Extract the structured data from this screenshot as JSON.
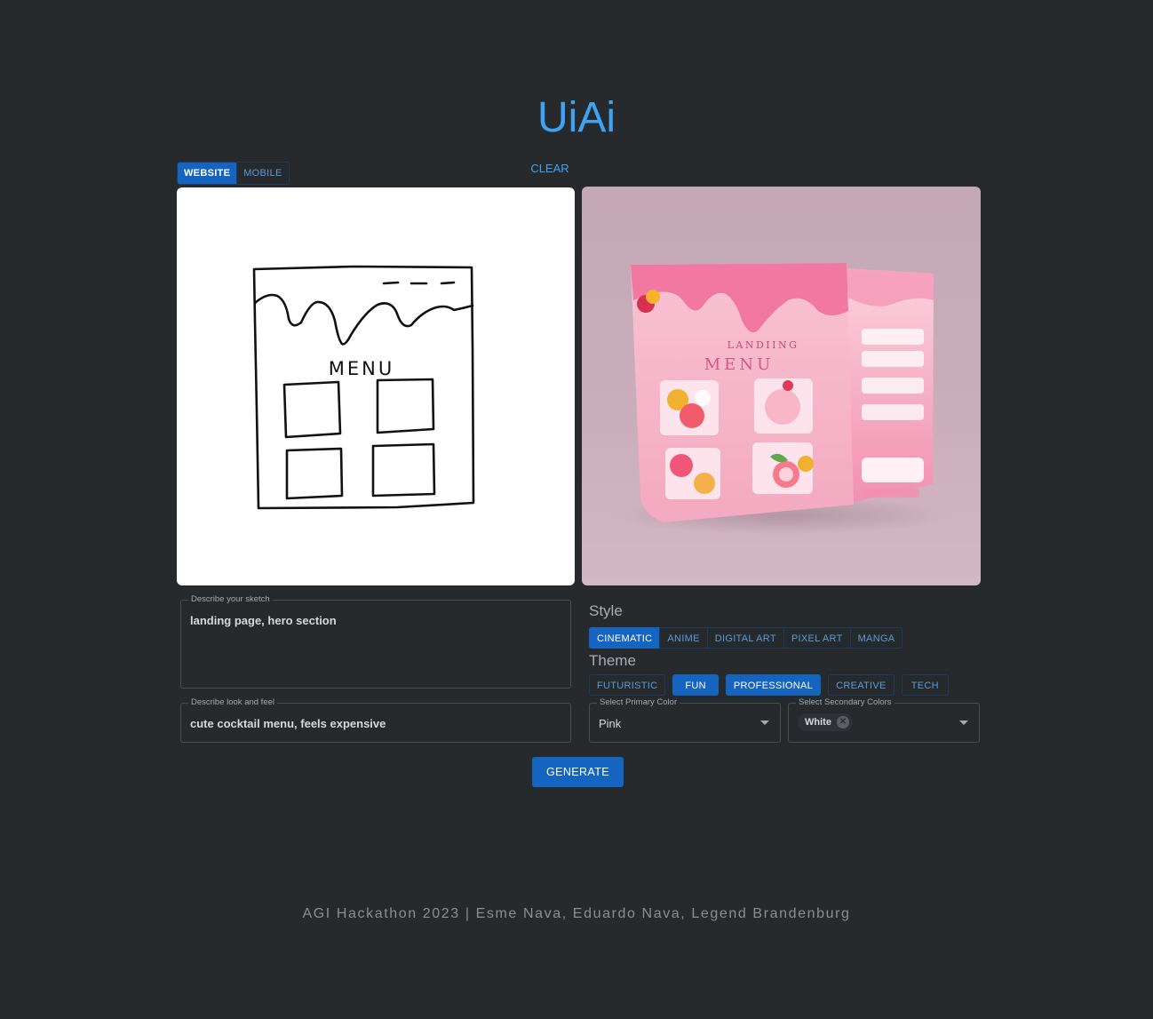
{
  "app": {
    "title": "UiAi"
  },
  "mode_toggle": {
    "website_label": "WEBSITE",
    "mobile_label": "MOBILE",
    "selected": "WEBSITE"
  },
  "canvas": {
    "clear_label": "CLEAR",
    "sketch_text": "MENU"
  },
  "preview": {
    "heading_line1": "LANDIING",
    "heading_line2": "MENU"
  },
  "form": {
    "sketch_description": {
      "label": "Describe your sketch",
      "value": "landing page, hero section"
    },
    "look_and_feel": {
      "label": "Describe look and feel",
      "value": "cute cocktail menu, feels expensive"
    }
  },
  "style": {
    "heading": "Style",
    "options": [
      "CINEMATIC",
      "ANIME",
      "DIGITAL ART",
      "PIXEL ART",
      "MANGA"
    ],
    "selected": [
      "CINEMATIC"
    ]
  },
  "theme": {
    "heading": "Theme",
    "options": [
      "FUTURISTIC",
      "FUN",
      "PROFESSIONAL",
      "CREATIVE",
      "TECH"
    ],
    "selected": [
      "FUN",
      "PROFESSIONAL"
    ]
  },
  "primary_color": {
    "label": "Select Primary Color",
    "value": "Pink"
  },
  "secondary_colors": {
    "label": "Select Secondary Colors",
    "tags": [
      "White"
    ]
  },
  "actions": {
    "generate_label": "GENERATE"
  },
  "footer": {
    "text": "AGI Hackathon 2023 | Esme Nava, Eduardo Nava, Legend Brandenburg"
  },
  "colors": {
    "background": "#272a2d",
    "accent": "#3fa3f5",
    "primary_button": "#1565c0",
    "preview_pink": "#f48fb1"
  }
}
